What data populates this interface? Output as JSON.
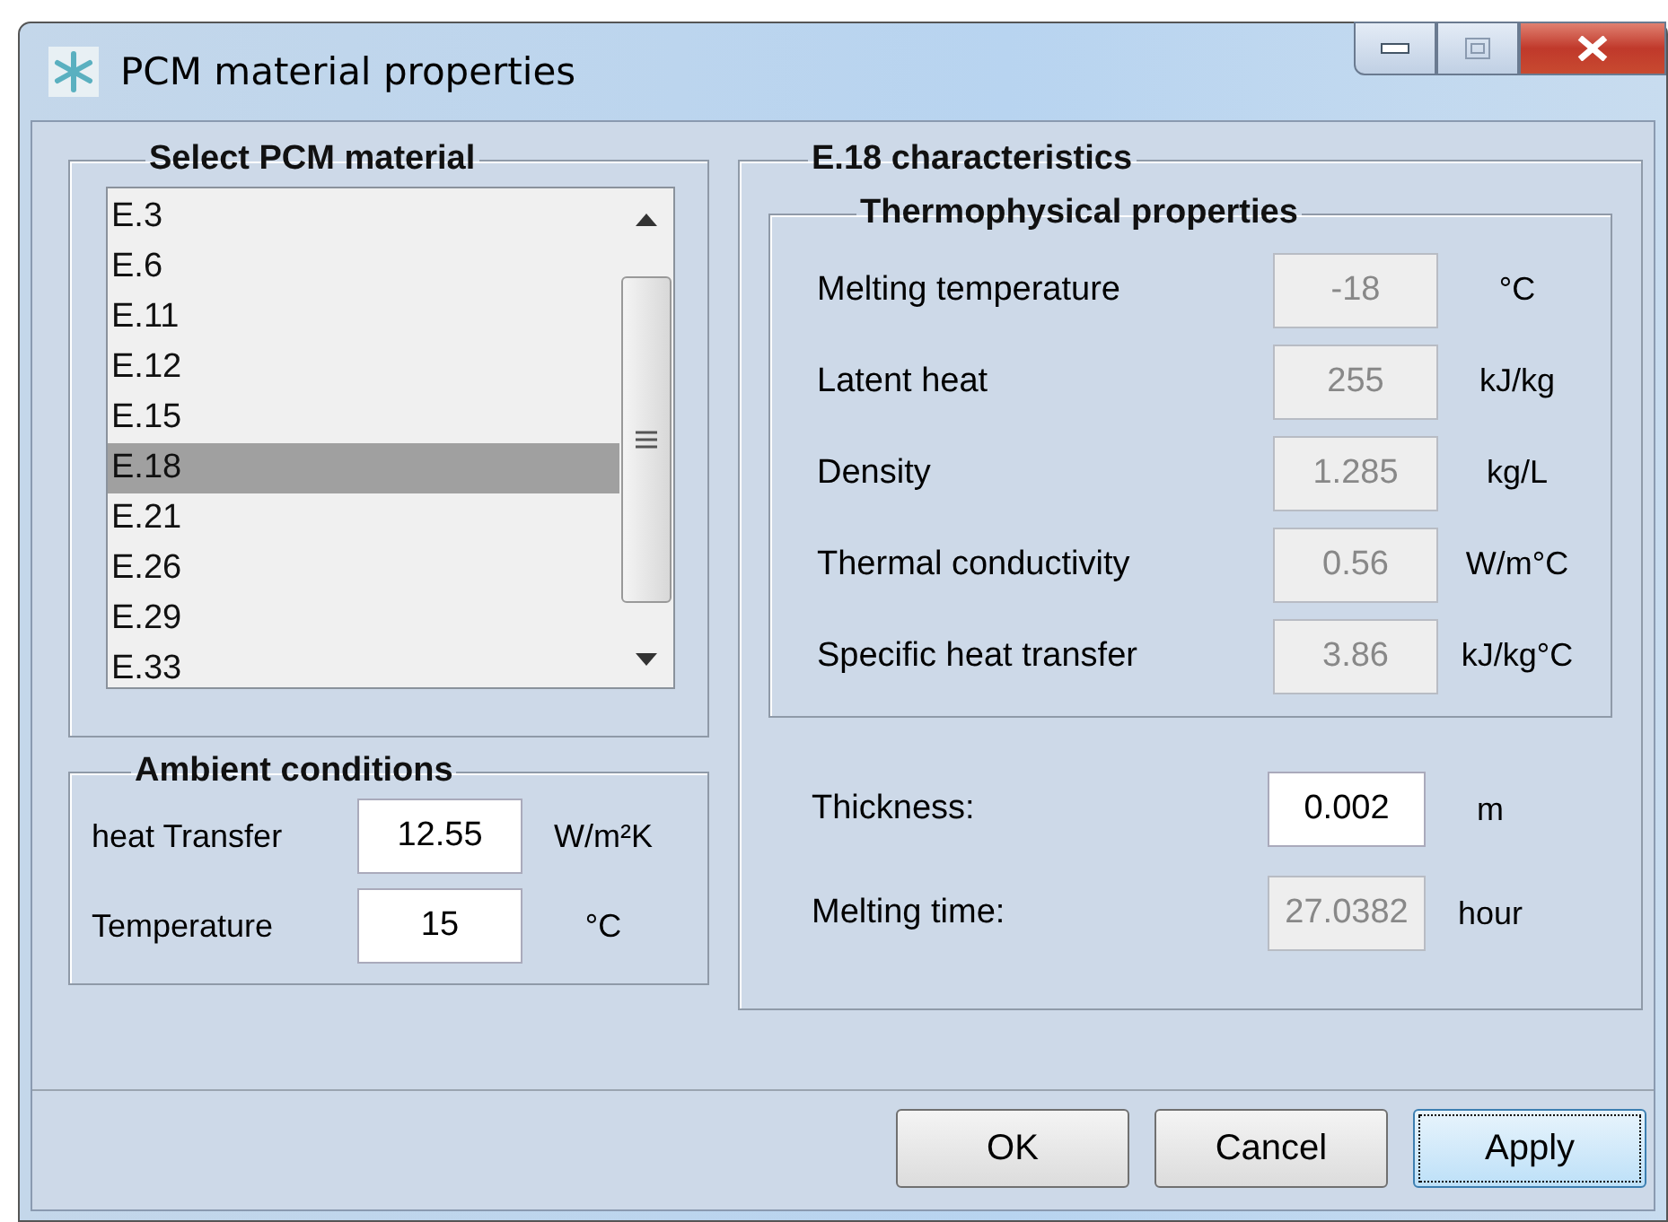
{
  "window": {
    "title": "PCM material properties"
  },
  "material_group": {
    "title": "Select PCM material",
    "items": [
      {
        "label": "E.3",
        "selected": false
      },
      {
        "label": "E.6",
        "selected": false
      },
      {
        "label": "E.11",
        "selected": false
      },
      {
        "label": "E.12",
        "selected": false
      },
      {
        "label": "E.15",
        "selected": false
      },
      {
        "label": "E.18",
        "selected": true
      },
      {
        "label": "E.21",
        "selected": false
      },
      {
        "label": "E.26",
        "selected": false
      },
      {
        "label": "E.29",
        "selected": false
      },
      {
        "label": "E.33",
        "selected": false
      }
    ]
  },
  "ambient_group": {
    "title": "Ambient conditions",
    "fields": [
      {
        "label": "heat Transfer",
        "value": "12.55",
        "unit": "W/m²K",
        "disabled": false
      },
      {
        "label": "Temperature",
        "value": "15",
        "unit": "°C",
        "disabled": false
      }
    ]
  },
  "characteristics_group": {
    "title": "E.18 characteristics",
    "thermo_group": {
      "title": "Thermophysical properties",
      "fields": [
        {
          "label": "Melting temperature",
          "value": "-18",
          "unit": "°C",
          "disabled": true
        },
        {
          "label": "Latent heat",
          "value": "255",
          "unit": "kJ/kg",
          "disabled": true
        },
        {
          "label": "Density",
          "value": "1.285",
          "unit": "kg/L",
          "disabled": true
        },
        {
          "label": "Thermal conductivity",
          "value": "0.56",
          "unit": "W/m°C",
          "disabled": true
        },
        {
          "label": "Specific heat transfer",
          "value": "3.86",
          "unit": "kJ/kg°C",
          "disabled": true
        }
      ]
    },
    "fields": [
      {
        "label": "Thickness:",
        "value": "0.002",
        "unit": "m",
        "disabled": false
      },
      {
        "label": "Melting time:",
        "value": "27.0382",
        "unit": "hour",
        "disabled": true
      }
    ]
  },
  "buttons": [
    {
      "label": "OK",
      "focused": false
    },
    {
      "label": "Cancel",
      "focused": false
    },
    {
      "label": "Apply",
      "focused": true
    }
  ]
}
